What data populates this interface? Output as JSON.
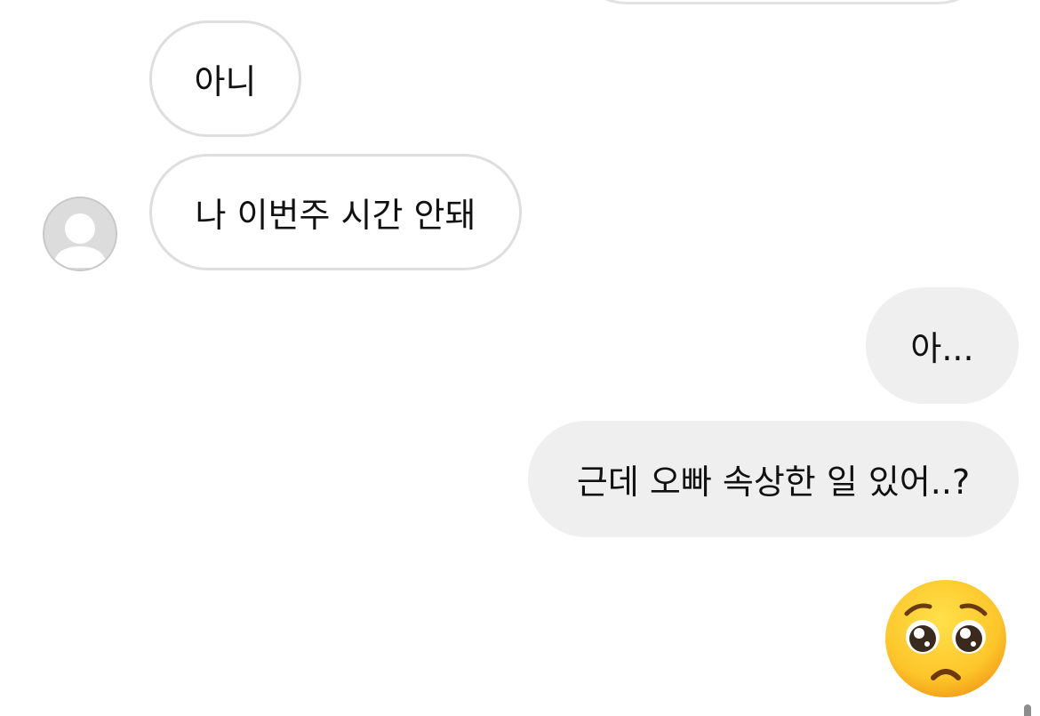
{
  "messages": {
    "incoming_1": "아니",
    "incoming_2": "나 이번주 시간 안돼",
    "outgoing_1": "아...",
    "outgoing_2": "근데 오빠 속상한 일 있어..?"
  },
  "avatar": {
    "icon": "default-user-silhouette"
  },
  "emoji": {
    "icon": "pleading-face-emoji"
  },
  "colors": {
    "incoming_bubble_border": "#dedede",
    "outgoing_bubble_bg": "#efefef",
    "text": "#111111",
    "background": "#ffffff"
  }
}
